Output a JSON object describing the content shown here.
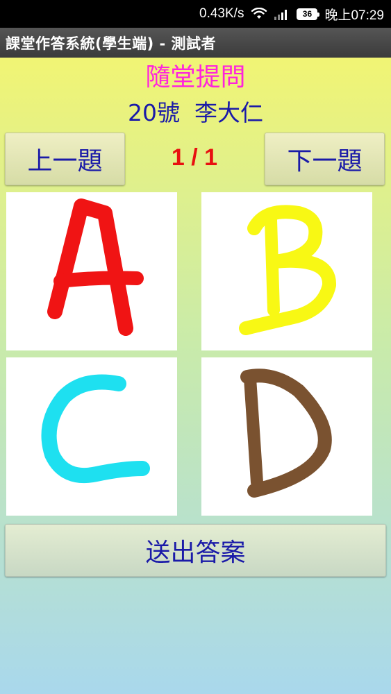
{
  "status_bar": {
    "network_speed": "0.43K/s",
    "battery_level": "36",
    "time": "晚上07:29",
    "icons": [
      "wifi-icon",
      "signal-icon",
      "battery-icon"
    ]
  },
  "app": {
    "title": "課堂作答系統(學生端) - 測試者"
  },
  "main": {
    "mode_title": "隨堂提問",
    "student_info": "20號  李大仁",
    "prev_label": "上一題",
    "next_label": "下一題",
    "page_indicator": "1 / 1",
    "options": [
      {
        "letter": "A",
        "color": "#f01414"
      },
      {
        "letter": "B",
        "color": "#f8f814"
      },
      {
        "letter": "C",
        "color": "#1ee0f0"
      },
      {
        "letter": "D",
        "color": "#7a5230"
      }
    ],
    "submit_label": "送出答案"
  },
  "colors": {
    "mode_title": "#ff22dd",
    "text_blue": "#1a1aa8",
    "page_indicator": "#e81010"
  }
}
